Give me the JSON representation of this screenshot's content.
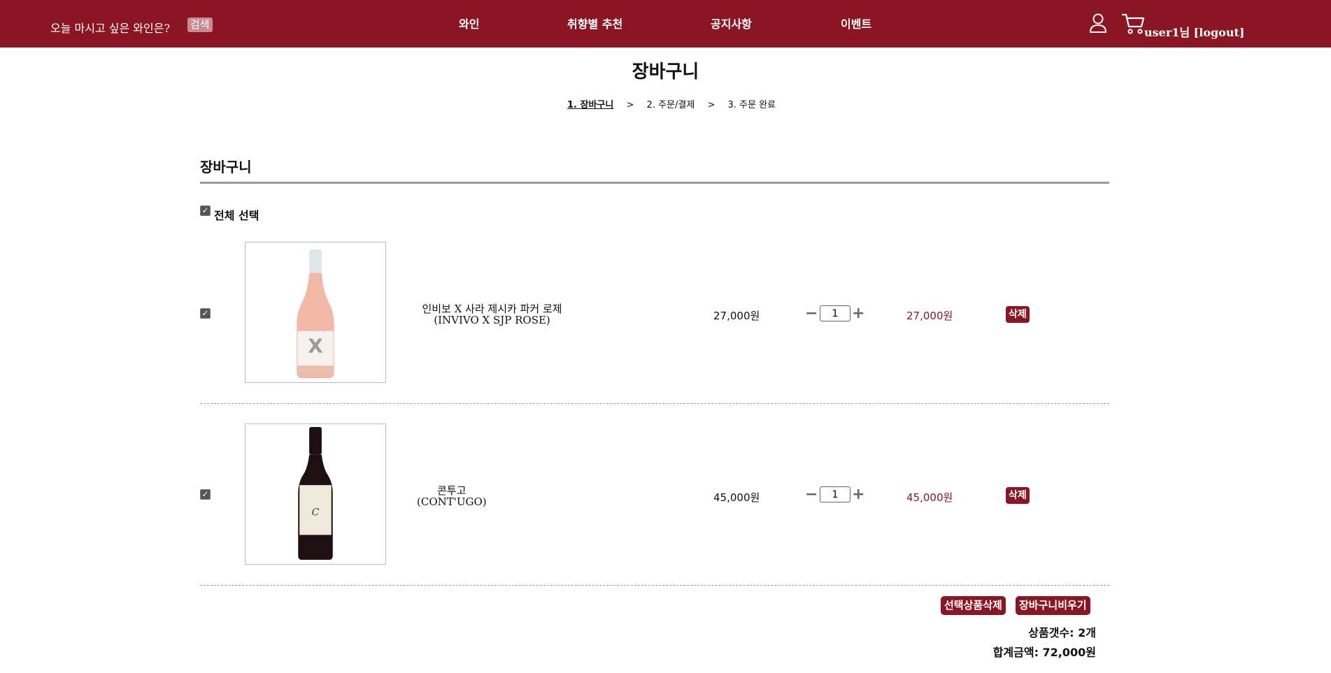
{
  "header": {
    "search_prompt": "오늘 마시고 싶은 와인은?",
    "search_button": "검색",
    "nav": [
      "와인",
      "취향별 추천",
      "공지사항",
      "이벤트"
    ],
    "user_greeting": "user1님 [logout]",
    "icons": {
      "user": "user-icon",
      "cart": "cart-icon"
    }
  },
  "page_title": "장바구니",
  "steps": [
    "1. 장바구니",
    "2. 주문/결제",
    "3. 주문 완료"
  ],
  "step_separator": ">",
  "section_title": "장바구니",
  "select_all_label": "전체 선택",
  "checkbox_mark": "✓",
  "items": [
    {
      "name_line1": "인비보 X 사라 제시카 파커 로제",
      "name_line2": "(INVIVO X SJP ROSE)",
      "price": "27,000원",
      "quantity": "1",
      "subtotal": "27,000원",
      "delete_label": "삭제",
      "image": "rose-wine-bottle"
    },
    {
      "name_line1": "콘투고",
      "name_line2": "(CONT'UGO)",
      "price": "45,000원",
      "quantity": "1",
      "subtotal": "45,000원",
      "delete_label": "삭제",
      "image": "red-wine-bottle"
    }
  ],
  "qty_minus": "−",
  "qty_plus": "+",
  "actions": {
    "delete_selected": "선택상품삭제",
    "clear_cart": "장바구니비우기"
  },
  "summary": {
    "count": "상품갯수: 2개",
    "total": "합계금액: 72,000원"
  },
  "colors": {
    "brand": "#8a1623",
    "search_button": "#c98a92"
  }
}
